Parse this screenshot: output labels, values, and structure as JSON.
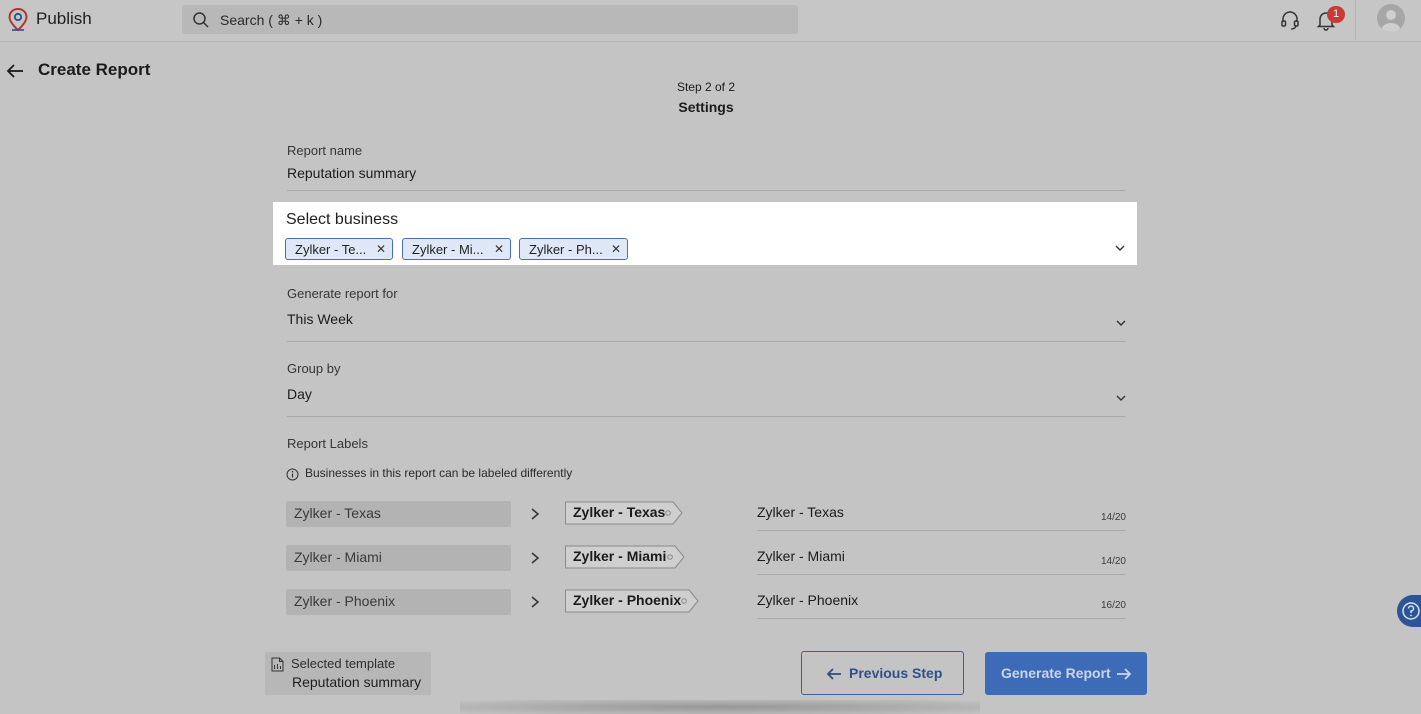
{
  "header": {
    "app_name": "Publish",
    "search_placeholder": "Search ( ⌘ + k )",
    "notification_count": "1"
  },
  "page": {
    "title": "Create Report",
    "step_label": "Step 2 of 2",
    "step_title": "Settings"
  },
  "form": {
    "report_name": {
      "label": "Report name",
      "value": "Reputation summary"
    },
    "select_business": {
      "label": "Select business",
      "chips": [
        "Zylker - Te...",
        "Zylker - Mi...",
        "Zylker - Ph..."
      ]
    },
    "generate_report_for": {
      "label": "Generate report for",
      "value": "This Week"
    },
    "group_by": {
      "label": "Group by",
      "value": "Day"
    },
    "report_labels": {
      "label": "Report Labels",
      "info": "Businesses in this report can be labeled differently",
      "rows": [
        {
          "source": "Zylker - Texas",
          "preview": "Zylker - Texas",
          "value": "Zylker - Texas",
          "count": "14/20"
        },
        {
          "source": "Zylker - Miami",
          "preview": "Zylker - Miami",
          "value": "Zylker - Miami",
          "count": "14/20"
        },
        {
          "source": "Zylker - Phoenix",
          "preview": "Zylker - Phoenix",
          "value": "Zylker - Phoenix",
          "count": "16/20"
        }
      ]
    }
  },
  "footer": {
    "template_label": "Selected template",
    "template_name": "Reputation summary",
    "previous_label": "Previous Step",
    "generate_label": "Generate Report"
  },
  "colors": {
    "accent": "#3e6bb8",
    "badge": "#c73b3b",
    "chip_border": "#4c6fb1"
  },
  "icons": [
    "app-logo-icon",
    "search-icon",
    "headset-icon",
    "bell-icon",
    "avatar-icon",
    "back-arrow-icon",
    "close-icon",
    "chevron-down-icon",
    "info-icon",
    "chevron-right-icon",
    "template-file-icon",
    "arrow-left-icon",
    "arrow-right-icon",
    "help-icon"
  ]
}
